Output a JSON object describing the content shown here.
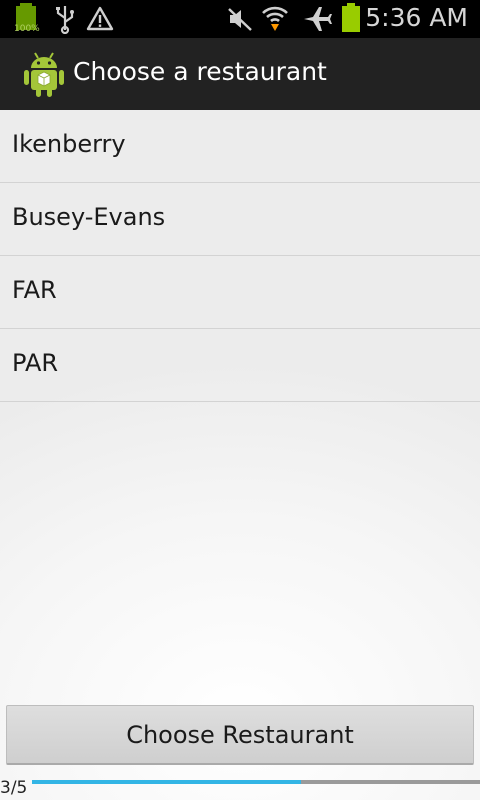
{
  "status_bar": {
    "time": "5:36 AM",
    "battery_percent_label": "100%",
    "icons": [
      "battery-full-icon",
      "usb-icon",
      "warning-icon",
      "mute-icon",
      "wifi-icon",
      "airplane-mode-icon",
      "battery-icon"
    ],
    "battery_color": "#99cc00"
  },
  "action_bar": {
    "title": "Choose a restaurant",
    "app_icon": "android-icon"
  },
  "restaurants": [
    {
      "label": "Ikenberry"
    },
    {
      "label": "Busey-Evans"
    },
    {
      "label": "FAR"
    },
    {
      "label": "PAR"
    }
  ],
  "choose_button": {
    "label": "Choose Restaurant"
  },
  "pager": {
    "indicator": "3/5",
    "progress": 0.6,
    "accent_color": "#33b5e5"
  }
}
